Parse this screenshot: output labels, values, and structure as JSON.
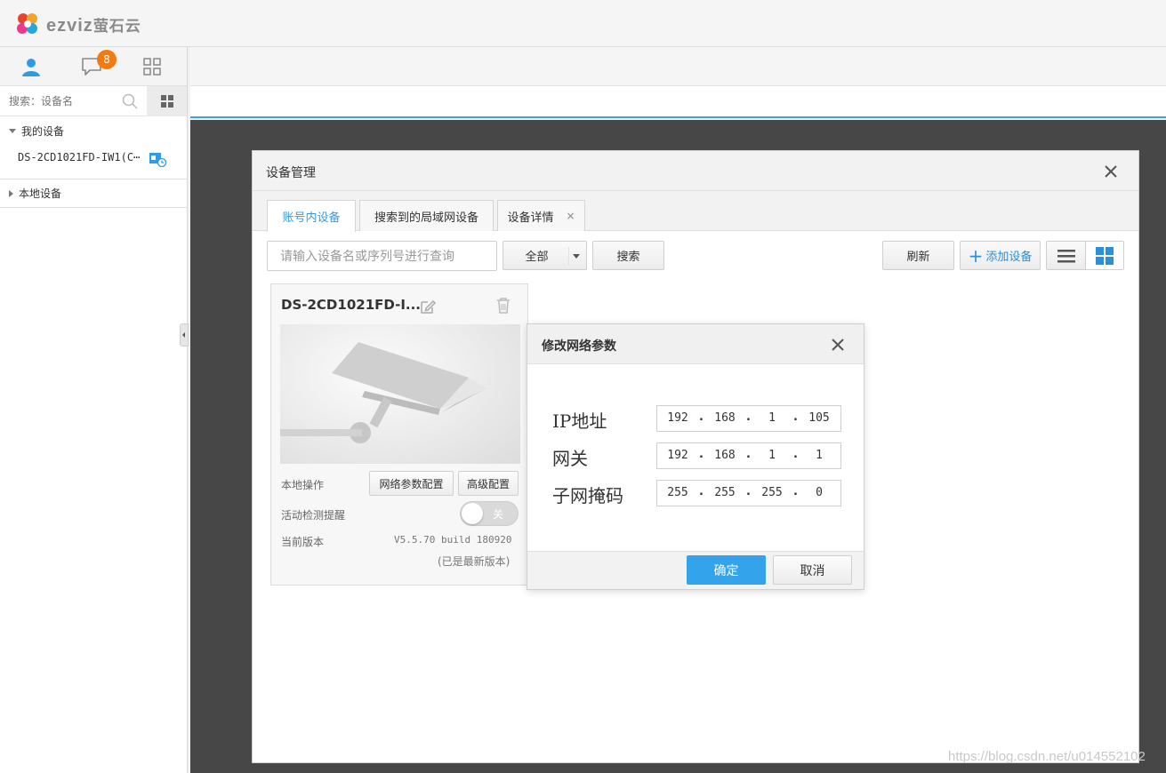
{
  "brand": {
    "logo_text": "ezviz",
    "logo_cn": "萤石云"
  },
  "sidebar": {
    "tabs": [
      {
        "icon": "user-icon",
        "active": true
      },
      {
        "icon": "message-icon",
        "badge": "8"
      },
      {
        "icon": "apps-grid-icon"
      }
    ],
    "search_placeholder": "搜索：设备名",
    "groups": [
      {
        "label": "我的设备",
        "expanded": true,
        "devices": [
          {
            "name": "DS-2CD1021FD-IW1(C⋯"
          }
        ]
      },
      {
        "label": "本地设备",
        "expanded": false
      }
    ]
  },
  "dialog": {
    "title": "设备管理",
    "tabs": [
      {
        "label": "账号内设备",
        "active": true
      },
      {
        "label": "搜索到的局域网设备"
      },
      {
        "label": "设备详情",
        "closable": true
      }
    ],
    "tab_close_glyph": "×",
    "toolbar": {
      "search_placeholder": "请输入设备名或序列号进行查询",
      "filter_value": "全部",
      "search_label": "搜索",
      "refresh_label": "刷新",
      "add_label": "添加设备",
      "add_glyph": "+"
    },
    "device_card": {
      "name": "DS-2CD1021FD-I...",
      "local_ops_label": "本地操作",
      "net_config_label": "网络参数配置",
      "advanced_label": "高级配置",
      "motion_alert_label": "活动检测提醒",
      "toggle_text": "关",
      "motion_alert_on": false,
      "version_label": "当前版本",
      "version_value": "V5.5.70 build 180920",
      "version_note": "(已是最新版本)"
    }
  },
  "net_dialog": {
    "title": "修改网络参数",
    "fields": [
      {
        "label": "IP地址",
        "octets": [
          "192",
          "168",
          "1",
          "105"
        ]
      },
      {
        "label": "网关",
        "octets": [
          "192",
          "168",
          "1",
          "1"
        ]
      },
      {
        "label": "子网掩码",
        "octets": [
          "255",
          "255",
          "255",
          "0"
        ]
      }
    ],
    "dot": ".",
    "ok_label": "确定",
    "cancel_label": "取消"
  },
  "watermark": "https://blog.csdn.net/u014552102",
  "colors": {
    "accent": "#33a3ec",
    "badge": "#f47a10",
    "stage": "#474747"
  }
}
